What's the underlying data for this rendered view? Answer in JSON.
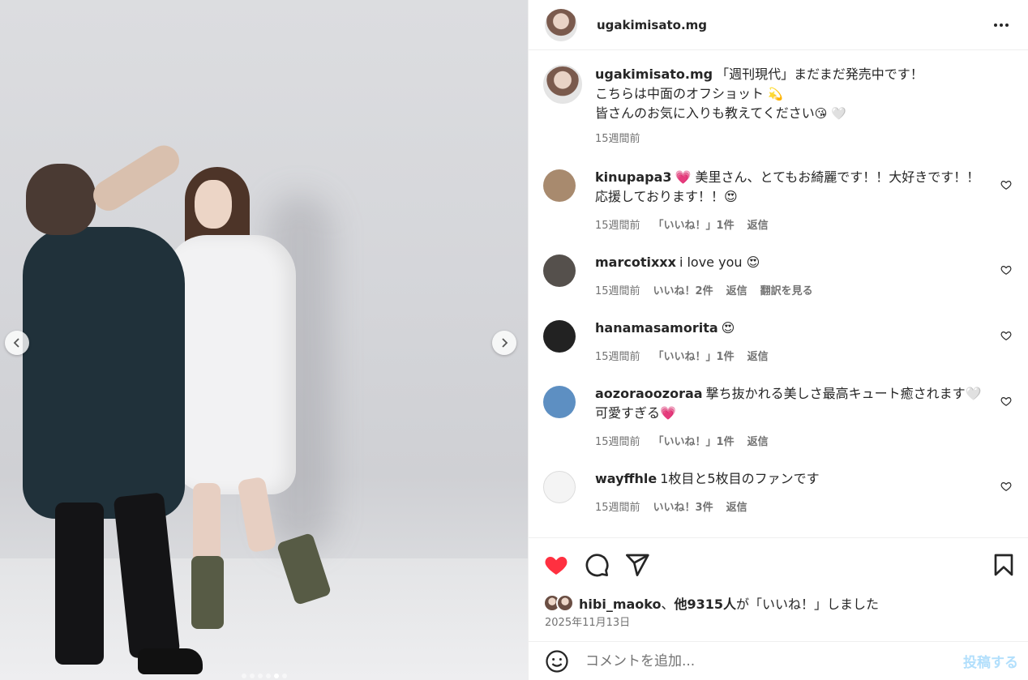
{
  "photo": {
    "prev_icon": "chevron-left-icon",
    "next_icon": "chevron-right-icon",
    "carousel_count": 6,
    "carousel_active_index": 4
  },
  "header": {
    "username": "ugakimisato.mg",
    "more_icon": "more-horizontal-icon"
  },
  "caption": {
    "username": "ugakimisato.mg",
    "line1": "「週刊現代」まだまだ発売中です！",
    "line2": "こちらは中面のオフショット",
    "line2_emoji": "💫",
    "line3": "皆さんのお気に入りも教えてください",
    "line3_emoji": "😘 🤍",
    "time": "15週間前"
  },
  "comments": [
    {
      "username": "kinupapa3",
      "text": "💗 美里さん、とてもお綺麗です！！大好きです！！応援しております！！😍",
      "time": "15週間前",
      "likes": "「いいね！」1件",
      "reply": "返信",
      "translate": ""
    },
    {
      "username": "marcotixxx",
      "text": "i love you 😍",
      "time": "15週間前",
      "likes": "いいね！2件",
      "reply": "返信",
      "translate": "翻訳を見る"
    },
    {
      "username": "hanamasamorita",
      "text": "😍",
      "time": "15週間前",
      "likes": "「いいね！」1件",
      "reply": "返信",
      "translate": ""
    },
    {
      "username": "aozoraoozoraa",
      "text": "撃ち抜かれる美しさ最高キュート癒されます🤍 可愛すぎる💗",
      "time": "15週間前",
      "likes": "「いいね！」1件",
      "reply": "返信",
      "translate": ""
    },
    {
      "username": "wayffhle",
      "text": "1枚目と5枚目のファンです",
      "time": "15週間前",
      "likes": "いいね！3件",
      "reply": "返信",
      "translate": ""
    }
  ],
  "actions": {
    "like_icon": "heart-filled-icon",
    "comment_icon": "comment-icon",
    "share_icon": "share-icon",
    "save_icon": "bookmark-icon",
    "like_color": "#ff3040"
  },
  "likes": {
    "user": "hibi_maoko",
    "separator": "、",
    "others": "他9315人",
    "suffix": "が「いいね！」しました"
  },
  "date": "2025年11月13日",
  "add_comment": {
    "placeholder": "コメントを追加...",
    "post_label": "投稿する",
    "emoji_icon": "smiley-icon"
  }
}
